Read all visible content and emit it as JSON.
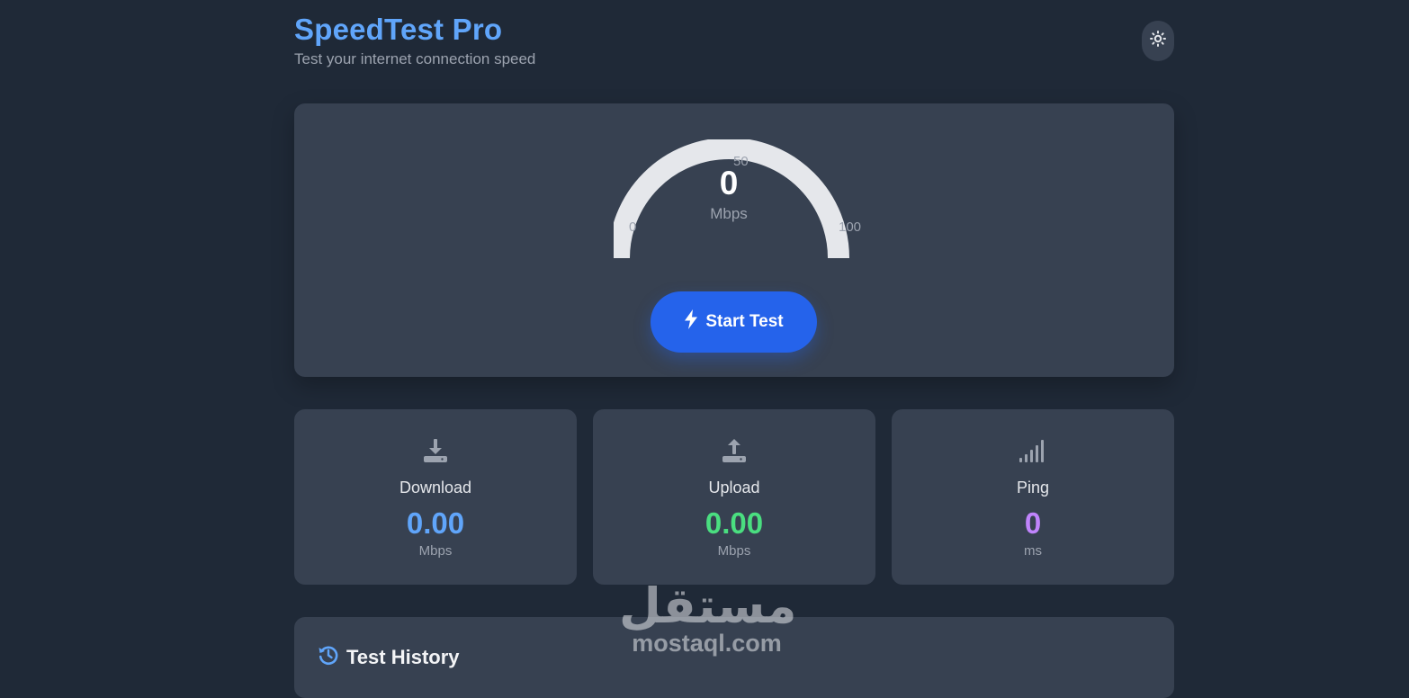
{
  "header": {
    "title": "SpeedTest Pro",
    "subtitle": "Test your internet connection speed",
    "theme_toggle_icon": "sun-icon"
  },
  "gauge": {
    "value": "0",
    "unit": "Mbps",
    "ticks": {
      "min": "0",
      "mid": "50",
      "max": "100"
    },
    "fill_fraction": 0,
    "track_color": "#e5e7eb"
  },
  "start_button": {
    "label": "Start Test",
    "icon": "bolt-icon",
    "color": "#2563eb"
  },
  "stats": {
    "download": {
      "icon": "download-icon",
      "label": "Download",
      "value": "0.00",
      "unit": "Mbps",
      "color": "#60a5fa"
    },
    "upload": {
      "icon": "upload-icon",
      "label": "Upload",
      "value": "0.00",
      "unit": "Mbps",
      "color": "#4ade80"
    },
    "ping": {
      "icon": "signal-icon",
      "label": "Ping",
      "value": "0",
      "unit": "ms",
      "color": "#c084fc"
    }
  },
  "history": {
    "title": "Test History",
    "icon": "history-icon"
  },
  "watermark": {
    "arabic": "مستقل",
    "latin": "mostaql.com"
  },
  "colors": {
    "background": "#1f2937",
    "card": "#374151",
    "accent": "#60a5fa"
  }
}
